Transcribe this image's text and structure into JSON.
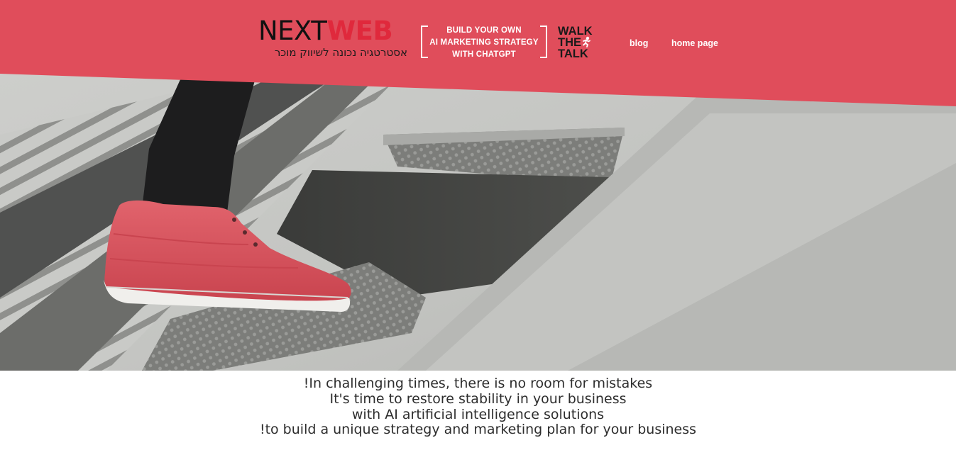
{
  "colors": {
    "brand_red": "#e04d5b",
    "logo_red": "#e0293c",
    "sneaker_red": "#d9535d",
    "text_dark": "#2d2d2d"
  },
  "header": {
    "logo": {
      "word_next": "NEXT",
      "word_web": "WEB",
      "tagline": "אסטרטגיה נכונה לשיווק מוכר"
    },
    "promo": {
      "line1": "BUILD YOUR OWN",
      "line2": "AI MARKETING  STRATEGY",
      "line3": "WITH CHATGPT"
    },
    "walk_the_talk": {
      "line1": "WALK",
      "line2": "THE",
      "line3": "TALK",
      "icon": "runner-icon"
    },
    "nav": {
      "blog": "blog",
      "home": "home page"
    }
  },
  "hero": {
    "image": "red-sneaker-on-metal-stairs"
  },
  "intro": {
    "line1": "!In challenging times, there is no room for mistakes",
    "line2": "It's time to restore stability in your business",
    "line3": "with AI artificial intelligence solutions",
    "line4": "!to build a unique strategy and marketing plan for your business"
  }
}
